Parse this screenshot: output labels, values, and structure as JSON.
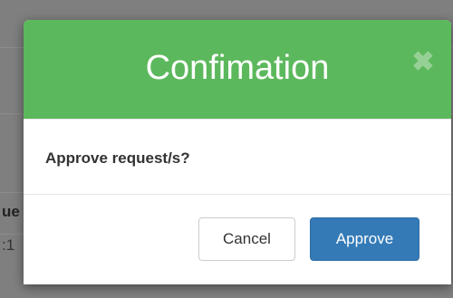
{
  "background": {
    "row_header_fragment": "ue",
    "row_value_fragment": ":1",
    "sort_icon": "sort-icon"
  },
  "modal": {
    "title": "Confimation",
    "close_icon": "close-icon",
    "body_text": "Approve request/s?",
    "cancel_label": "Cancel",
    "approve_label": "Approve"
  },
  "colors": {
    "header_bg": "#5cb85c",
    "approve_bg": "#337ab7",
    "overlay": "#7f7f7f"
  }
}
